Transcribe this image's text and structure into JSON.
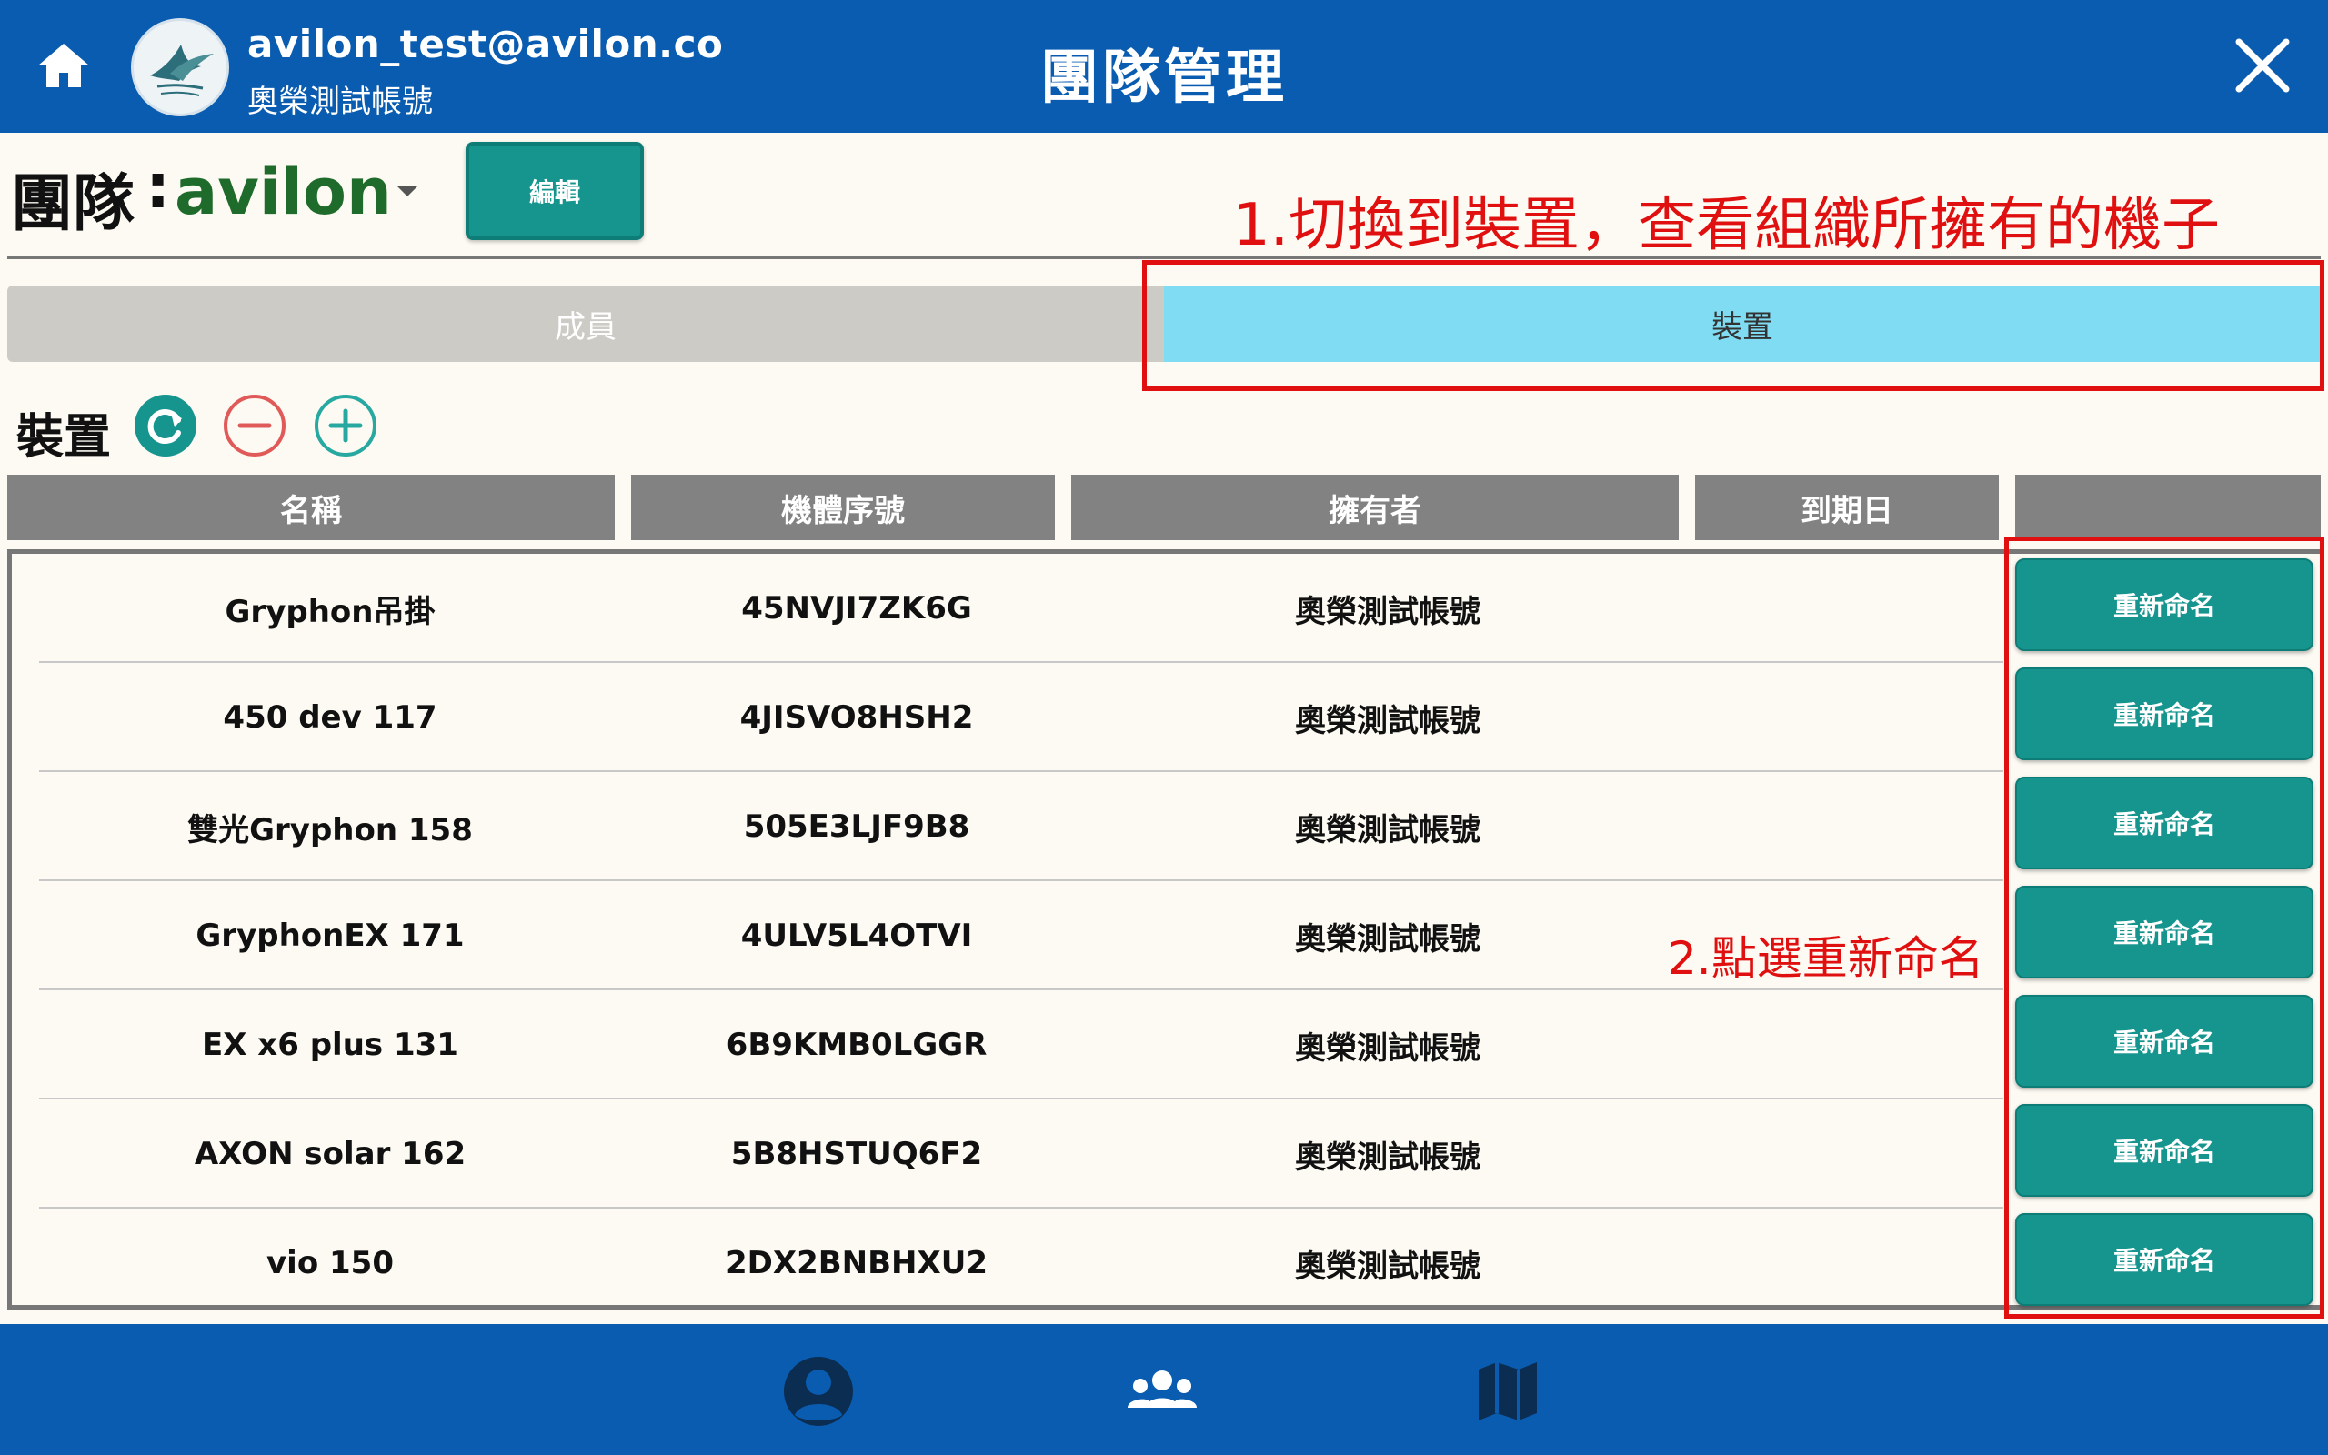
{
  "header": {
    "account_email": "avilon_test@avilon.co",
    "account_name": "奧榮測試帳號",
    "title": "團隊管理",
    "icons": [
      "home-icon",
      "bird-logo-avatar",
      "close-icon"
    ],
    "colors": {
      "bar": "#0a5cb0"
    }
  },
  "team": {
    "label": "團隊",
    "colon": ":",
    "name": "avilon",
    "edit_label": "編輯"
  },
  "tabs": [
    {
      "label": "成員",
      "active": false
    },
    {
      "label": "裝置",
      "active": true
    }
  ],
  "section": {
    "title": "裝置",
    "actions": [
      "refresh-icon",
      "remove-icon",
      "add-icon"
    ]
  },
  "table": {
    "headers": [
      "名稱",
      "機體序號",
      "擁有者",
      "到期日",
      ""
    ],
    "rows": [
      {
        "name": "Gryphon吊掛",
        "serial": "45NVJI7ZK6G",
        "owner": "奧榮測試帳號",
        "expiry": "",
        "action": "重新命名"
      },
      {
        "name": "450 dev 117",
        "serial": "4JISVO8HSH2",
        "owner": "奧榮測試帳號",
        "expiry": "",
        "action": "重新命名"
      },
      {
        "name": "雙光Gryphon 158",
        "serial": "505E3LJF9B8",
        "owner": "奧榮測試帳號",
        "expiry": "",
        "action": "重新命名"
      },
      {
        "name": "GryphonEX 171",
        "serial": "4ULV5L4OTVI",
        "owner": "奧榮測試帳號",
        "expiry": "",
        "action": "重新命名"
      },
      {
        "name": "EX x6 plus 131",
        "serial": "6B9KMB0LGGR",
        "owner": "奧榮測試帳號",
        "expiry": "",
        "action": "重新命名"
      },
      {
        "name": "AXON solar 162",
        "serial": "5B8HSTUQ6F2",
        "owner": "奧榮測試帳號",
        "expiry": "",
        "action": "重新命名"
      },
      {
        "name": "vio 150",
        "serial": "2DX2BNBHXU2",
        "owner": "奧榮測試帳號",
        "expiry": "",
        "action": "重新命名"
      }
    ]
  },
  "annotations": {
    "step1": "1.切換到裝置，查看組織所擁有的機子",
    "step2": "2.點選重新命名",
    "color": "#e01010"
  },
  "bottom_nav": {
    "items": [
      "person-icon",
      "team-icon",
      "map-icon"
    ]
  },
  "colors": {
    "accent_teal": "#16958f",
    "active_tab": "#7fdcf3",
    "team_name": "#1f6b2b"
  }
}
